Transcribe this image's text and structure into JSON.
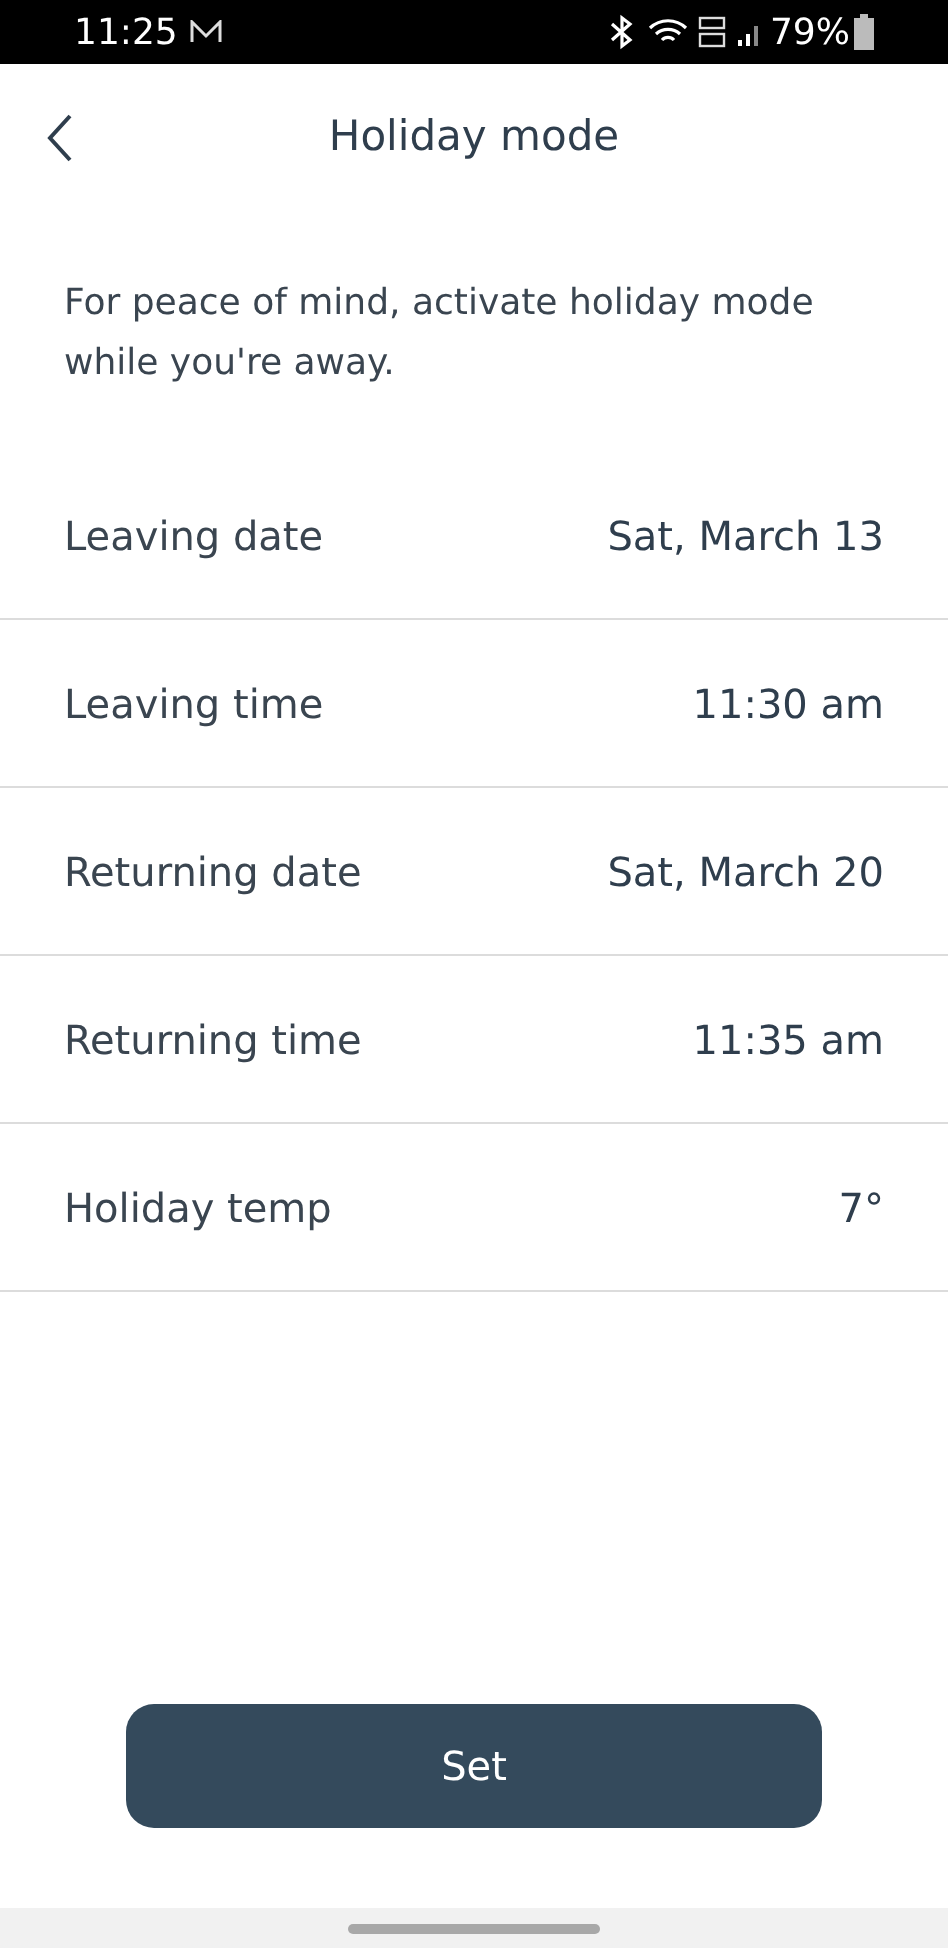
{
  "status_bar": {
    "time": "11:25",
    "battery_text": "79%"
  },
  "header": {
    "title": "Holiday mode"
  },
  "intro": "For peace of mind, activate holiday mode while you're away.",
  "settings": [
    {
      "label": "Leaving date",
      "value": "Sat, March 13"
    },
    {
      "label": "Leaving time",
      "value": "11:30 am"
    },
    {
      "label": "Returning date",
      "value": "Sat, March 20"
    },
    {
      "label": "Returning time",
      "value": "11:35 am"
    },
    {
      "label": "Holiday temp",
      "value": "7°"
    }
  ],
  "button": "Set"
}
